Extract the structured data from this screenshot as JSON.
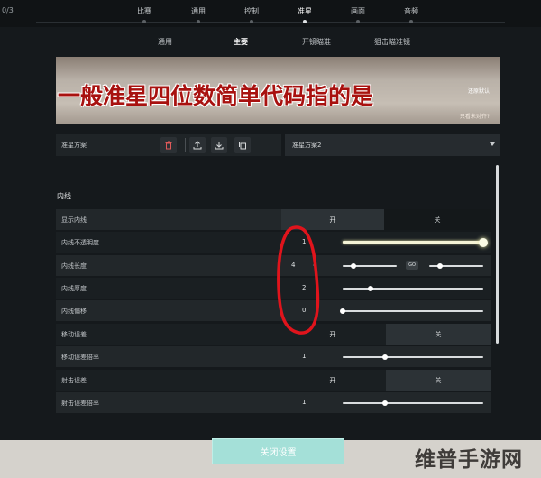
{
  "header": {
    "counter": "0/3",
    "tabs": [
      {
        "label": "比赛",
        "active": false
      },
      {
        "label": "通用",
        "active": false
      },
      {
        "label": "控制",
        "active": false
      },
      {
        "label": "准星",
        "active": true
      },
      {
        "label": "画面",
        "active": false
      },
      {
        "label": "音频",
        "active": false
      }
    ]
  },
  "subtabs": [
    {
      "label": "通用",
      "active": false
    },
    {
      "label": "主要",
      "active": true
    },
    {
      "label": "开镜瞄准",
      "active": false
    },
    {
      "label": "狙击瞄准镜",
      "active": false
    }
  ],
  "banner": {
    "title": "一般准星四位数简单代码指的是",
    "small_top": "还原默认",
    "small_bottom": "只看未对齐?"
  },
  "preset": {
    "label": "准星方案",
    "value": "准星方案2",
    "icons": [
      "delete-icon",
      "upload-icon",
      "download-icon",
      "copy-icon"
    ]
  },
  "section": {
    "title": "内线"
  },
  "rows": [
    {
      "label": "显示内线",
      "on": "开",
      "off": "关"
    },
    {
      "label": "内线不透明度",
      "value": "1"
    },
    {
      "label": "内线长度",
      "value_a": "4",
      "value_b": "4",
      "link": "GO"
    },
    {
      "label": "内线厚度",
      "value": "2"
    },
    {
      "label": "内线偏移",
      "value": "0"
    },
    {
      "label": "移动误差",
      "on": "开",
      "off": "关"
    },
    {
      "label": "移动误差倍率",
      "value": "1"
    },
    {
      "label": "射击误差",
      "on": "开",
      "off": "关"
    },
    {
      "label": "射击误差倍率",
      "value": "1"
    }
  ],
  "slider_levels": {
    "opacity": 1.0,
    "length_a": 0.2,
    "length_b": 0.2,
    "thickness": 0.2,
    "offset": 0.0,
    "move_error_mult": 0.3,
    "fire_error_mult": 0.3
  },
  "footer": {
    "close_label": "关闭设置"
  },
  "watermark": "维普手游网",
  "colors": {
    "accent": "#a4e0d8",
    "annotation": "#e0141c",
    "banner_text": "#a8110f"
  }
}
